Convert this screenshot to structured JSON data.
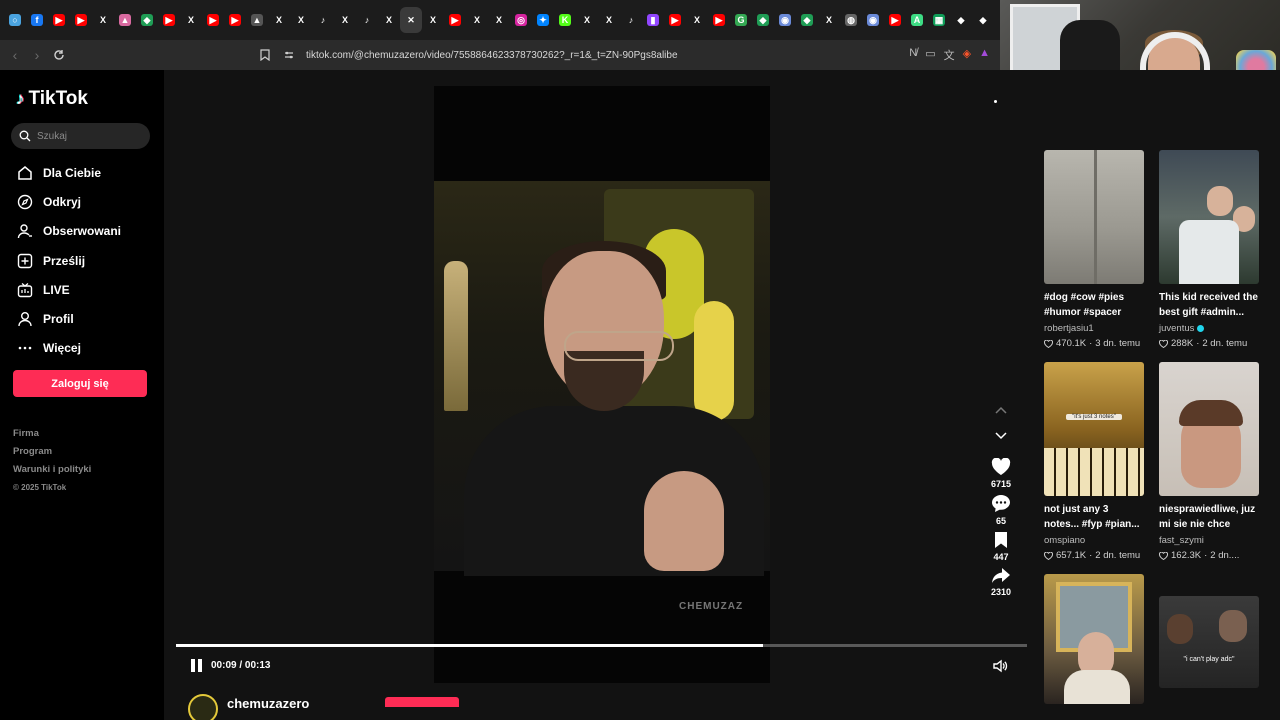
{
  "browser": {
    "tabs": [
      {
        "icon": "chrome-icon",
        "color": "#4aa3df",
        "glyph": "○"
      },
      {
        "icon": "facebook-icon",
        "color": "#1877f2",
        "glyph": "f"
      },
      {
        "icon": "youtube-icon",
        "color": "#ff0000",
        "glyph": "▶"
      },
      {
        "icon": "youtube-icon",
        "color": "#ff0000",
        "glyph": "▶"
      },
      {
        "icon": "x-icon",
        "color": "#000000",
        "glyph": "X"
      },
      {
        "icon": "generic-icon",
        "color": "#d96aa0",
        "glyph": "▲"
      },
      {
        "icon": "green-icon",
        "color": "#1f9d55",
        "glyph": "◆"
      },
      {
        "icon": "youtube-icon",
        "color": "#ff0000",
        "glyph": "▶"
      },
      {
        "icon": "x-icon",
        "color": "#000000",
        "glyph": "X"
      },
      {
        "icon": "youtube-icon",
        "color": "#ff0000",
        "glyph": "▶"
      },
      {
        "icon": "youtube-icon",
        "color": "#ff0000",
        "glyph": "▶"
      },
      {
        "icon": "generic-icon",
        "color": "#555555",
        "glyph": "▲"
      },
      {
        "icon": "x-icon",
        "color": "#000000",
        "glyph": "X"
      },
      {
        "icon": "x-icon",
        "color": "#000000",
        "glyph": "X"
      },
      {
        "icon": "tiktok-icon",
        "color": "#000000",
        "glyph": "♪"
      },
      {
        "icon": "x-icon",
        "color": "#000000",
        "glyph": "X"
      },
      {
        "icon": "tiktok-icon",
        "color": "#000000",
        "glyph": "♪"
      },
      {
        "icon": "x-icon",
        "color": "#000000",
        "glyph": "X"
      },
      {
        "icon": "close-tab-icon",
        "color": "#3a3a3a",
        "glyph": "✕",
        "active": true
      },
      {
        "icon": "x-icon",
        "color": "#000000",
        "glyph": "X"
      },
      {
        "icon": "youtube-icon",
        "color": "#ff0000",
        "glyph": "▶"
      },
      {
        "icon": "x-icon",
        "color": "#000000",
        "glyph": "X"
      },
      {
        "icon": "x-icon",
        "color": "#000000",
        "glyph": "X"
      },
      {
        "icon": "instagram-icon",
        "color": "#d6249f",
        "glyph": "◎"
      },
      {
        "icon": "messenger-icon",
        "color": "#0084ff",
        "glyph": "✦"
      },
      {
        "icon": "kick-icon",
        "color": "#53fc18",
        "glyph": "K"
      },
      {
        "icon": "x-icon",
        "color": "#000000",
        "glyph": "X"
      },
      {
        "icon": "x-icon",
        "color": "#000000",
        "glyph": "X"
      },
      {
        "icon": "tiktok-icon",
        "color": "#000000",
        "glyph": "♪"
      },
      {
        "icon": "twitch-icon",
        "color": "#9146ff",
        "glyph": "▮"
      },
      {
        "icon": "youtube-icon",
        "color": "#ff0000",
        "glyph": "▶"
      },
      {
        "icon": "x-icon",
        "color": "#000000",
        "glyph": "X"
      },
      {
        "icon": "youtube-icon",
        "color": "#ff0000",
        "glyph": "▶"
      },
      {
        "icon": "google-icon",
        "color": "#34a853",
        "glyph": "G"
      },
      {
        "icon": "green-icon",
        "color": "#1f9d55",
        "glyph": "◆"
      },
      {
        "icon": "generic-icon",
        "color": "#6a8ad8",
        "glyph": "◉"
      },
      {
        "icon": "green-icon",
        "color": "#1f9d55",
        "glyph": "◆"
      },
      {
        "icon": "x-icon",
        "color": "#000000",
        "glyph": "X"
      },
      {
        "icon": "globe-icon",
        "color": "#666666",
        "glyph": "◍"
      },
      {
        "icon": "generic-icon",
        "color": "#6a8ad8",
        "glyph": "◉"
      },
      {
        "icon": "youtube-icon",
        "color": "#ff0000",
        "glyph": "▶"
      },
      {
        "icon": "android-icon",
        "color": "#3ddc84",
        "glyph": "A"
      },
      {
        "icon": "sheets-icon",
        "color": "#0f9d58",
        "glyph": "▦"
      },
      {
        "icon": "diamond-icon",
        "color": "#000000",
        "glyph": "◆"
      },
      {
        "icon": "diamond-icon",
        "color": "#000000",
        "glyph": "◆"
      }
    ],
    "url": "tiktok.com/@chemuzazero/video/7558864623378730262?_r=1&_t=ZN-90Pgs8alibe"
  },
  "sidebar": {
    "logo_text": "TikTok",
    "search_placeholder": "Szukaj",
    "nav": [
      {
        "label": "Dla Ciebie",
        "icon": "home-icon"
      },
      {
        "label": "Odkryj",
        "icon": "compass-icon"
      },
      {
        "label": "Obserwowani",
        "icon": "following-icon"
      },
      {
        "label": "Prześlij",
        "icon": "upload-icon"
      },
      {
        "label": "LIVE",
        "icon": "live-icon"
      },
      {
        "label": "Profil",
        "icon": "profile-icon"
      },
      {
        "label": "Więcej",
        "icon": "more-icon"
      }
    ],
    "login_label": "Zaloguj się",
    "footer": [
      "Firma",
      "Program",
      "Warunki i polityki"
    ],
    "copyright": "© 2025 TikTok"
  },
  "video": {
    "watermark": "CHEMUZAZ",
    "time": "00:09 / 00:13",
    "progress": 0.69,
    "likes": "6715",
    "comments": "65",
    "saves": "447",
    "shares": "2310",
    "username": "chemuzazero"
  },
  "recommendations": [
    {
      "title": "#dog #cow #pies #humor #spacer",
      "user": "robertjasiu1",
      "verified": false,
      "likes": "470.1K",
      "age": "3 dn. temu",
      "thumb_text": ""
    },
    {
      "title": "This kid received the best gift #admin...",
      "user": "juventus",
      "verified": true,
      "likes": "288K",
      "age": "2 dn. temu",
      "thumb_text": ""
    },
    {
      "title": "not just any 3 notes... #fyp #pian...",
      "user": "omspiano",
      "verified": false,
      "likes": "657.1K",
      "age": "2 dn. temu",
      "thumb_text": "\"it's just 3 notes\""
    },
    {
      "title": "niesprawiedliwe, juz mi sie nie chce uczyc",
      "user": "fast_szymi",
      "verified": false,
      "likes": "162.3K",
      "age": "2 dn....",
      "thumb_text": ""
    },
    {
      "title": "",
      "user": "",
      "verified": false,
      "likes": "",
      "age": "",
      "thumb_text": ""
    },
    {
      "title": "",
      "user": "",
      "verified": false,
      "likes": "",
      "age": "",
      "thumb_text": "\"i can't play adc\""
    }
  ]
}
